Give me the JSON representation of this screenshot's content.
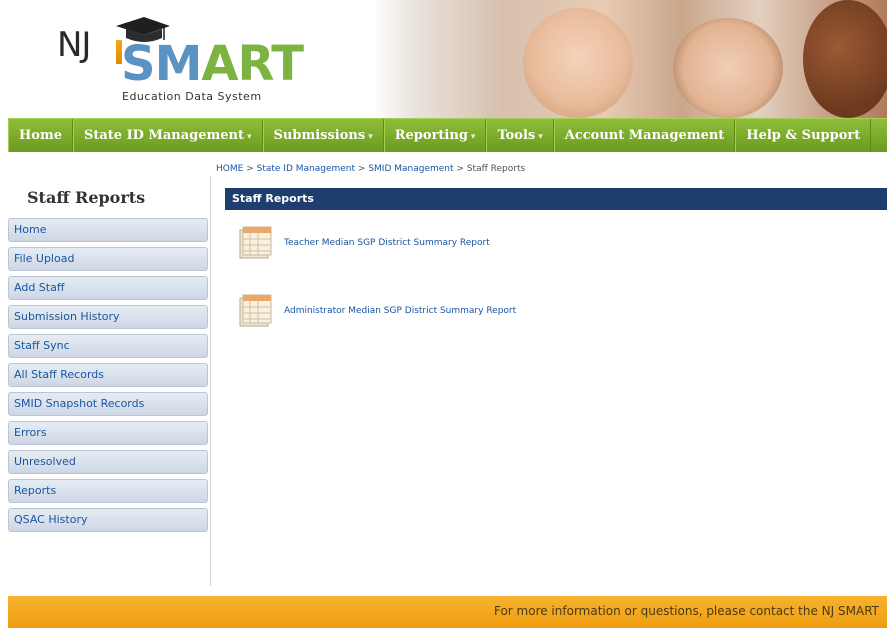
{
  "brand": {
    "prefix": "NJ",
    "name_start": "SM",
    "name_end": "ART",
    "subtitle": "Education Data System"
  },
  "nav": {
    "items": [
      {
        "label": "Home",
        "dropdown": false
      },
      {
        "label": "State ID Management",
        "dropdown": true
      },
      {
        "label": "Submissions",
        "dropdown": true
      },
      {
        "label": "Reporting",
        "dropdown": true
      },
      {
        "label": "Tools",
        "dropdown": true
      },
      {
        "label": "Account Management",
        "dropdown": false
      },
      {
        "label": "Help & Support",
        "dropdown": false
      }
    ]
  },
  "breadcrumb": {
    "items": [
      "HOME",
      "State ID Management",
      "SMID Management"
    ],
    "separator": ">",
    "current": "Staff Reports"
  },
  "sidebar": {
    "title": "Staff Reports",
    "items": [
      "Home",
      "File Upload",
      "Add Staff",
      "Submission History",
      "Staff Sync",
      "All Staff Records",
      "SMID Snapshot Records",
      "Errors",
      "Unresolved",
      "Reports",
      "QSAC History"
    ]
  },
  "panel": {
    "title": "Staff Reports"
  },
  "reports": [
    {
      "label": "Teacher Median SGP District Summary Report",
      "icon": "spreadsheet-report-icon"
    },
    {
      "label": "Administrator Median SGP District Summary Report",
      "icon": "spreadsheet-report-icon"
    }
  ],
  "footer": {
    "text": "For more information or questions, please contact the NJ SMART"
  },
  "colors": {
    "nav_green": "#7cb342",
    "panel_blue": "#1e3f6e",
    "footer_orange": "#f5a623",
    "link_blue": "#1a56a0"
  }
}
